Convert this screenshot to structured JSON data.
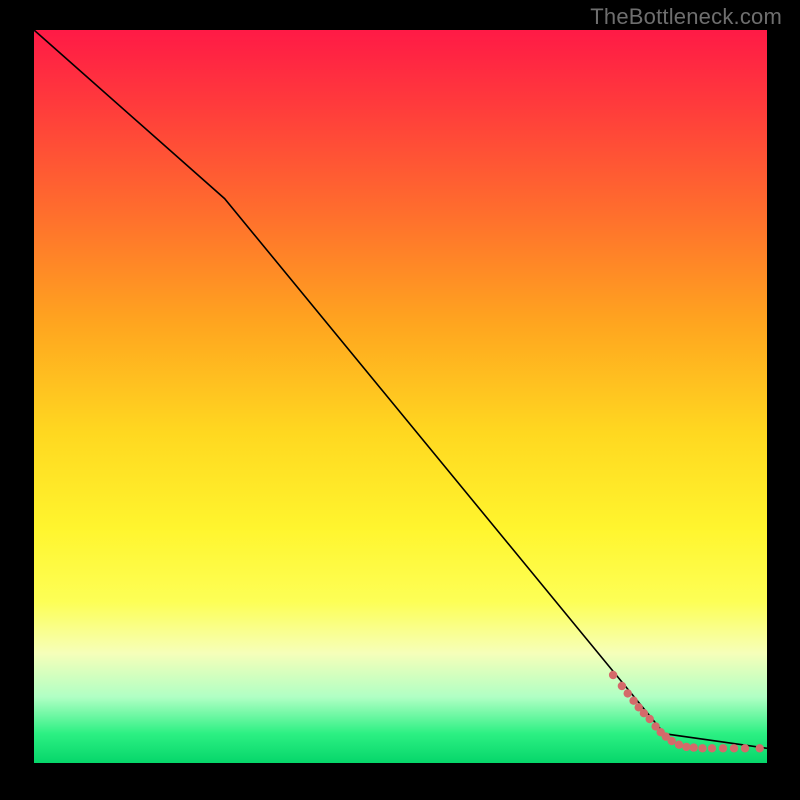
{
  "watermark": "TheBottleneck.com",
  "chart_data": {
    "type": "line",
    "title": "",
    "xlabel": "",
    "ylabel": "",
    "xlim": [
      0,
      100
    ],
    "ylim": [
      0,
      100
    ],
    "curve": [
      {
        "x": 0,
        "y": 100
      },
      {
        "x": 26,
        "y": 77
      },
      {
        "x": 86,
        "y": 4
      },
      {
        "x": 100,
        "y": 2
      }
    ],
    "series": [
      {
        "name": "points",
        "color": "#d46a6a",
        "points": [
          {
            "x": 79.0,
            "y": 12.0
          },
          {
            "x": 80.2,
            "y": 10.5
          },
          {
            "x": 81.0,
            "y": 9.5
          },
          {
            "x": 81.8,
            "y": 8.5
          },
          {
            "x": 82.5,
            "y": 7.6
          },
          {
            "x": 83.2,
            "y": 6.8
          },
          {
            "x": 84.0,
            "y": 6.0
          },
          {
            "x": 84.8,
            "y": 5.0
          },
          {
            "x": 85.5,
            "y": 4.2
          },
          {
            "x": 86.2,
            "y": 3.6
          },
          {
            "x": 87.0,
            "y": 3.0
          },
          {
            "x": 88.0,
            "y": 2.5
          },
          {
            "x": 89.0,
            "y": 2.2
          },
          {
            "x": 90.0,
            "y": 2.1
          },
          {
            "x": 91.2,
            "y": 2.0
          },
          {
            "x": 92.5,
            "y": 2.0
          },
          {
            "x": 94.0,
            "y": 2.0
          },
          {
            "x": 95.5,
            "y": 2.0
          },
          {
            "x": 97.0,
            "y": 2.0
          },
          {
            "x": 99.0,
            "y": 2.0
          }
        ]
      }
    ]
  }
}
